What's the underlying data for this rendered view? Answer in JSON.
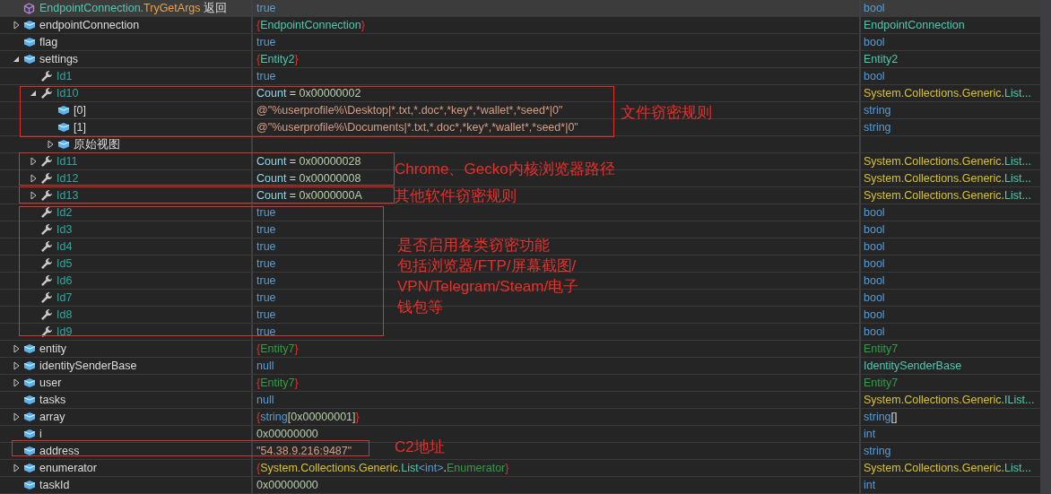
{
  "rows": [
    {
      "kind": "method",
      "selected": true,
      "name": [
        {
          "text": "EndpointConnection.",
          "kind": "class"
        },
        {
          "text": "TryGetArgs",
          "kind": "method"
        },
        {
          "text": " 返回",
          "kind": "plain"
        }
      ],
      "value": [
        {
          "text": "true",
          "kind": "keyword"
        }
      ],
      "type": [
        {
          "text": "bool",
          "kind": "keyword"
        }
      ]
    },
    {
      "kind": "field",
      "selected": false,
      "expanded": false,
      "name": [
        {
          "text": "endpointConnection",
          "kind": "plain"
        }
      ],
      "value": [
        {
          "text": "{",
          "kind": "brace"
        },
        {
          "text": "EndpointConnection",
          "kind": "class"
        },
        {
          "text": "}",
          "kind": "brace"
        }
      ],
      "type": [
        {
          "text": "EndpointConnection",
          "kind": "class"
        }
      ]
    },
    {
      "kind": "field",
      "selected": false,
      "name": [
        {
          "text": "flag",
          "kind": "plain"
        }
      ],
      "value": [
        {
          "text": "true",
          "kind": "keyword"
        }
      ],
      "type": [
        {
          "text": "bool",
          "kind": "keyword"
        }
      ]
    },
    {
      "kind": "field",
      "selected": false,
      "expanded": true,
      "name": [
        {
          "text": "settings",
          "kind": "plain"
        }
      ],
      "value": [
        {
          "text": "{",
          "kind": "brace"
        },
        {
          "text": "Entity2",
          "kind": "class"
        },
        {
          "text": "}",
          "kind": "brace"
        }
      ],
      "type": [
        {
          "text": "Entity2",
          "kind": "class"
        }
      ],
      "children": [
        {
          "kind": "property",
          "selected": false,
          "name": [
            {
              "text": "Id1",
              "kind": "property"
            }
          ],
          "value": [
            {
              "text": "true",
              "kind": "keyword"
            }
          ],
          "type": [
            {
              "text": "bool",
              "kind": "keyword"
            }
          ]
        },
        {
          "kind": "property",
          "selected": false,
          "expanded": true,
          "name": [
            {
              "text": "Id10",
              "kind": "property"
            }
          ],
          "value": [
            {
              "text": "Count",
              "kind": "member"
            },
            {
              "text": " = ",
              "kind": "plain"
            },
            {
              "text": "0x00000002",
              "kind": "number"
            }
          ],
          "type": [
            {
              "text": "System.Collections.Generic.",
              "kind": "namespace"
            },
            {
              "text": "List...",
              "kind": "class"
            }
          ],
          "children": [
            {
              "kind": "field",
              "selected": false,
              "name": [
                {
                  "text": "[0]",
                  "kind": "plain"
                }
              ],
              "value": [
                {
                  "text": "@\"%userprofile%\\Desktop|*.txt,*.doc*,*key*,*wallet*,*seed*|0\"",
                  "kind": "string"
                }
              ],
              "type": [
                {
                  "text": "string",
                  "kind": "keyword"
                }
              ]
            },
            {
              "kind": "field",
              "selected": false,
              "name": [
                {
                  "text": "[1]",
                  "kind": "plain"
                }
              ],
              "value": [
                {
                  "text": "@\"%userprofile%\\Documents|*.txt,*.doc*,*key*,*wallet*,*seed*|0\"",
                  "kind": "string"
                }
              ],
              "type": [
                {
                  "text": "string",
                  "kind": "keyword"
                }
              ]
            },
            {
              "kind": "field",
              "selected": false,
              "expanded": false,
              "name": [
                {
                  "text": "原始视图",
                  "kind": "plain"
                }
              ]
            }
          ]
        },
        {
          "kind": "property",
          "selected": false,
          "expanded": false,
          "name": [
            {
              "text": "Id11",
              "kind": "property"
            }
          ],
          "value": [
            {
              "text": "Count",
              "kind": "member"
            },
            {
              "text": " = ",
              "kind": "plain"
            },
            {
              "text": "0x00000028",
              "kind": "number"
            }
          ],
          "type": [
            {
              "text": "System.Collections.Generic.",
              "kind": "namespace"
            },
            {
              "text": "List...",
              "kind": "class"
            }
          ]
        },
        {
          "kind": "property",
          "selected": false,
          "expanded": false,
          "name": [
            {
              "text": "Id12",
              "kind": "property"
            }
          ],
          "value": [
            {
              "text": "Count",
              "kind": "member"
            },
            {
              "text": " = ",
              "kind": "plain"
            },
            {
              "text": "0x00000008",
              "kind": "number"
            }
          ],
          "type": [
            {
              "text": "System.Collections.Generic.",
              "kind": "namespace"
            },
            {
              "text": "List...",
              "kind": "class"
            }
          ]
        },
        {
          "kind": "property",
          "selected": false,
          "expanded": false,
          "name": [
            {
              "text": "Id13",
              "kind": "property"
            }
          ],
          "value": [
            {
              "text": "Count",
              "kind": "member"
            },
            {
              "text": " = ",
              "kind": "plain"
            },
            {
              "text": "0x0000000A",
              "kind": "number"
            }
          ],
          "type": [
            {
              "text": "System.Collections.Generic.",
              "kind": "namespace"
            },
            {
              "text": "List...",
              "kind": "class"
            }
          ]
        },
        {
          "kind": "property",
          "selected": false,
          "name": [
            {
              "text": "Id2",
              "kind": "property"
            }
          ],
          "value": [
            {
              "text": "true",
              "kind": "keyword"
            }
          ],
          "type": [
            {
              "text": "bool",
              "kind": "keyword"
            }
          ]
        },
        {
          "kind": "property",
          "selected": false,
          "name": [
            {
              "text": "Id3",
              "kind": "property"
            }
          ],
          "value": [
            {
              "text": "true",
              "kind": "keyword"
            }
          ],
          "type": [
            {
              "text": "bool",
              "kind": "keyword"
            }
          ]
        },
        {
          "kind": "property",
          "selected": false,
          "name": [
            {
              "text": "Id4",
              "kind": "property"
            }
          ],
          "value": [
            {
              "text": "true",
              "kind": "keyword"
            }
          ],
          "type": [
            {
              "text": "bool",
              "kind": "keyword"
            }
          ]
        },
        {
          "kind": "property",
          "selected": false,
          "name": [
            {
              "text": "Id5",
              "kind": "property"
            }
          ],
          "value": [
            {
              "text": "true",
              "kind": "keyword"
            }
          ],
          "type": [
            {
              "text": "bool",
              "kind": "keyword"
            }
          ]
        },
        {
          "kind": "property",
          "selected": false,
          "name": [
            {
              "text": "Id6",
              "kind": "property"
            }
          ],
          "value": [
            {
              "text": "true",
              "kind": "keyword"
            }
          ],
          "type": [
            {
              "text": "bool",
              "kind": "keyword"
            }
          ]
        },
        {
          "kind": "property",
          "selected": false,
          "name": [
            {
              "text": "Id7",
              "kind": "property"
            }
          ],
          "value": [
            {
              "text": "true",
              "kind": "keyword"
            }
          ],
          "type": [
            {
              "text": "bool",
              "kind": "keyword"
            }
          ]
        },
        {
          "kind": "property",
          "selected": false,
          "name": [
            {
              "text": "Id8",
              "kind": "property"
            }
          ],
          "value": [
            {
              "text": "true",
              "kind": "keyword"
            }
          ],
          "type": [
            {
              "text": "bool",
              "kind": "keyword"
            }
          ]
        },
        {
          "kind": "property",
          "selected": false,
          "name": [
            {
              "text": "Id9",
              "kind": "property"
            }
          ],
          "value": [
            {
              "text": "true",
              "kind": "keyword"
            }
          ],
          "type": [
            {
              "text": "bool",
              "kind": "keyword"
            }
          ]
        }
      ]
    },
    {
      "kind": "field",
      "selected": false,
      "expanded": false,
      "name": [
        {
          "text": "entity",
          "kind": "plain"
        }
      ],
      "value": [
        {
          "text": "{",
          "kind": "brace"
        },
        {
          "text": "Entity7",
          "kind": "entity"
        },
        {
          "text": "}",
          "kind": "brace"
        }
      ],
      "type": [
        {
          "text": "Entity7",
          "kind": "entity"
        }
      ]
    },
    {
      "kind": "field",
      "selected": false,
      "expanded": false,
      "name": [
        {
          "text": "identitySenderBase",
          "kind": "plain"
        }
      ],
      "value": [
        {
          "text": "null",
          "kind": "keyword"
        }
      ],
      "type": [
        {
          "text": "IdentitySenderBase",
          "kind": "class"
        }
      ]
    },
    {
      "kind": "field",
      "selected": false,
      "expanded": false,
      "name": [
        {
          "text": "user",
          "kind": "plain"
        }
      ],
      "value": [
        {
          "text": "{",
          "kind": "brace"
        },
        {
          "text": "Entity7",
          "kind": "entity"
        },
        {
          "text": "}",
          "kind": "brace"
        }
      ],
      "type": [
        {
          "text": "Entity7",
          "kind": "entity"
        }
      ]
    },
    {
      "kind": "field",
      "selected": false,
      "name": [
        {
          "text": "tasks",
          "kind": "plain"
        }
      ],
      "value": [
        {
          "text": "null",
          "kind": "keyword"
        }
      ],
      "type": [
        {
          "text": "System.Collections.Generic.",
          "kind": "namespace"
        },
        {
          "text": "IList...",
          "kind": "class"
        }
      ]
    },
    {
      "kind": "field",
      "selected": false,
      "expanded": false,
      "name": [
        {
          "text": "array",
          "kind": "plain"
        }
      ],
      "value": [
        {
          "text": "{",
          "kind": "brace"
        },
        {
          "text": "string",
          "kind": "keyword"
        },
        {
          "text": "[0x00000001]",
          "kind": "number"
        },
        {
          "text": "}",
          "kind": "brace"
        }
      ],
      "type": [
        {
          "text": "string",
          "kind": "keyword"
        },
        {
          "text": "[]",
          "kind": "plain"
        }
      ]
    },
    {
      "kind": "field",
      "selected": false,
      "name": [
        {
          "text": "i",
          "kind": "plain"
        }
      ],
      "value": [
        {
          "text": "0x00000000",
          "kind": "number"
        }
      ],
      "type": [
        {
          "text": "int",
          "kind": "keyword"
        }
      ]
    },
    {
      "kind": "field",
      "selected": false,
      "name": [
        {
          "text": "address",
          "kind": "plain"
        }
      ],
      "value": [
        {
          "text": "\"54.38.9.216:9487\"",
          "kind": "string"
        }
      ],
      "type": [
        {
          "text": "string",
          "kind": "keyword"
        }
      ]
    },
    {
      "kind": "field",
      "selected": false,
      "expanded": false,
      "name": [
        {
          "text": "enumerator",
          "kind": "plain"
        }
      ],
      "value": [
        {
          "text": "{",
          "kind": "brace"
        },
        {
          "text": "System.Collections.Generic.",
          "kind": "namespace"
        },
        {
          "text": "List",
          "kind": "class"
        },
        {
          "text": "<",
          "kind": "keyword"
        },
        {
          "text": "int",
          "kind": "keyword"
        },
        {
          "text": ">",
          "kind": "keyword"
        },
        {
          "text": ".",
          "kind": "plain"
        },
        {
          "text": "Enumerator",
          "kind": "entity"
        },
        {
          "text": "}",
          "kind": "brace"
        }
      ],
      "type": [
        {
          "text": "System.Collections.Generic.",
          "kind": "namespace"
        },
        {
          "text": "List...",
          "kind": "class"
        }
      ]
    },
    {
      "kind": "field",
      "selected": false,
      "name": [
        {
          "text": "taskId",
          "kind": "plain"
        }
      ],
      "value": [
        {
          "text": "0x00000000",
          "kind": "number"
        }
      ],
      "type": [
        {
          "text": "int",
          "kind": "keyword"
        }
      ]
    }
  ],
  "annotations": [
    {
      "lines": [
        "文件窃密规则"
      ]
    },
    {
      "lines": [
        "Chrome、Gecko内核浏览器路径"
      ]
    },
    {
      "lines": [
        "其他软件窃密规则"
      ]
    },
    {
      "lines": [
        "是否启用各类窃密功能",
        "包括浏览器/FTP/屏幕截图/",
        "VPN/Telegram/Steam/电子",
        "钱包等"
      ]
    },
    {
      "lines": [
        "C2地址"
      ]
    }
  ]
}
